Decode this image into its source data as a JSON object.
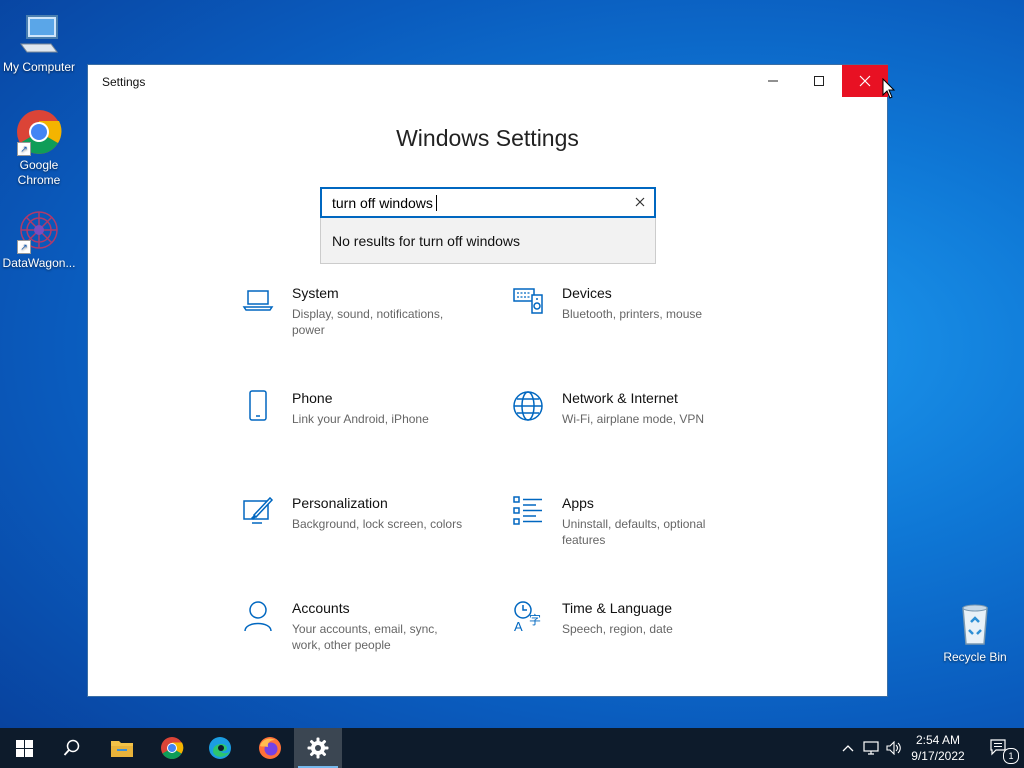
{
  "desktop": {
    "icons": [
      {
        "label": "My Computer",
        "icon": "computer-icon"
      },
      {
        "label": "Google Chrome",
        "icon": "chrome-icon"
      },
      {
        "label": "DataWagon...",
        "icon": "datawagon-icon"
      },
      {
        "label": "Recycle Bin",
        "icon": "recycle-bin-icon"
      }
    ]
  },
  "window": {
    "title": "Settings",
    "controls": {
      "minimize": "minimize-icon",
      "maximize": "maximize-icon",
      "close": "close-icon"
    }
  },
  "settings": {
    "heading": "Windows Settings",
    "search": {
      "value": "turn off windows",
      "no_results": "No results for turn off windows"
    },
    "tiles": [
      {
        "name": "System",
        "desc": "Display, sound, notifications, power",
        "icon": "laptop-icon"
      },
      {
        "name": "Devices",
        "desc": "Bluetooth, printers, mouse",
        "icon": "keyboard-speaker-icon"
      },
      {
        "name": "Phone",
        "desc": "Link your Android, iPhone",
        "icon": "phone-icon"
      },
      {
        "name": "Network & Internet",
        "desc": "Wi-Fi, airplane mode, VPN",
        "icon": "globe-icon"
      },
      {
        "name": "Personalization",
        "desc": "Background, lock screen, colors",
        "icon": "paintbrush-icon"
      },
      {
        "name": "Apps",
        "desc": "Uninstall, defaults, optional features",
        "icon": "apps-list-icon"
      },
      {
        "name": "Accounts",
        "desc": "Your accounts, email, sync, work, other people",
        "icon": "person-icon"
      },
      {
        "name": "Time & Language",
        "desc": "Speech, region, date",
        "icon": "time-language-icon"
      }
    ]
  },
  "taskbar": {
    "items": [
      "start-icon",
      "search-icon",
      "file-explorer-icon",
      "chrome-icon",
      "edge-icon",
      "firefox-icon",
      "settings-gear-icon"
    ],
    "active": "settings-gear-icon",
    "clock": {
      "time": "2:54 AM",
      "date": "9/17/2022"
    },
    "notifications_count": "1",
    "accent_color": "#0067c0",
    "close_color": "#e81123"
  }
}
